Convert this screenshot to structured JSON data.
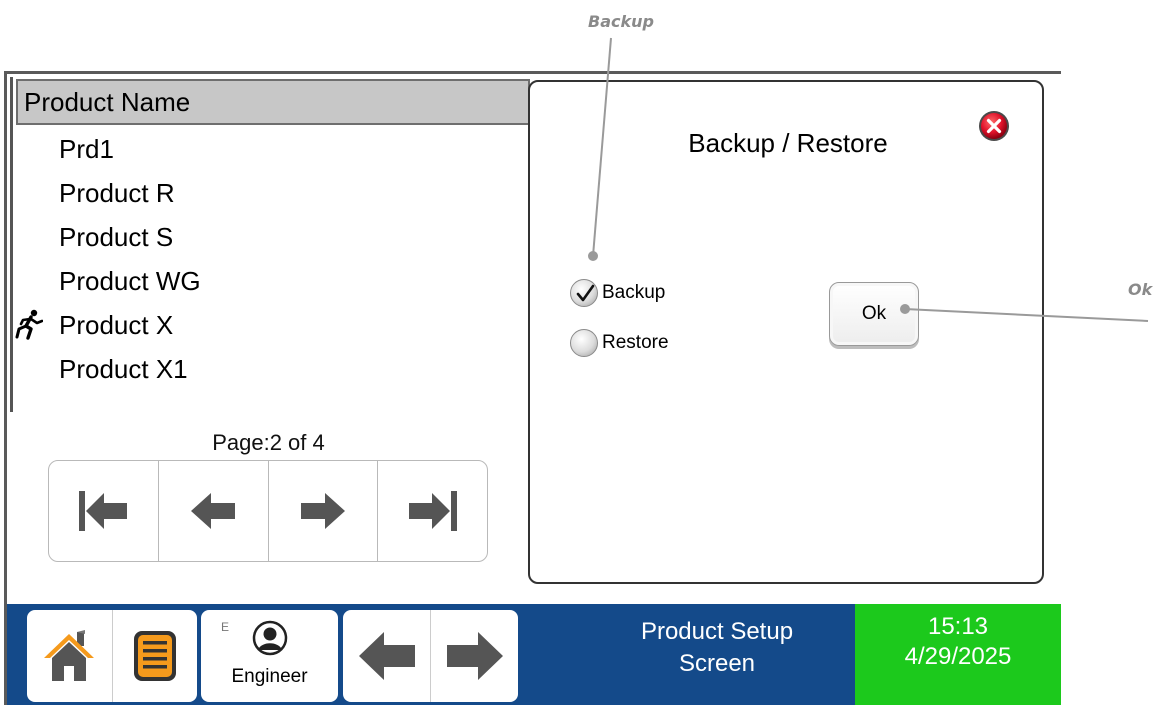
{
  "callouts": {
    "backup": "Backup",
    "ok": "Ok"
  },
  "product_list": {
    "header": "Product Name",
    "items": [
      {
        "name": "Prd1",
        "active": false
      },
      {
        "name": "Product R",
        "active": false
      },
      {
        "name": "Product S",
        "active": false
      },
      {
        "name": "Product WG",
        "active": false
      },
      {
        "name": "Product X",
        "active": true
      },
      {
        "name": "Product X1",
        "active": false
      }
    ],
    "page_label": "Page:2 of 4"
  },
  "dialog": {
    "title": "Backup / Restore",
    "options": [
      {
        "label": "Backup",
        "checked": true
      },
      {
        "label": "Restore",
        "checked": false
      }
    ],
    "ok_label": "Ok"
  },
  "navbar": {
    "user_level": "E",
    "user_name": "Engineer",
    "screen_name_line1": "Product Setup",
    "screen_name_line2": "Screen",
    "time": "15:13",
    "date": "4/29/2025"
  },
  "colors": {
    "navbar_bg": "#144a8a",
    "clock_bg": "#1cc91c",
    "home_icon": "#f59a1c",
    "menu_icon": "#f59a1c",
    "close_icon": "#e0132b",
    "arrow_gray": "#555555"
  },
  "icons": {
    "active_product": "runner-icon",
    "close": "close-icon",
    "home": "home-icon",
    "menu": "menu-icon",
    "user": "user-icon",
    "pager": [
      "first-page-icon",
      "previous-page-icon",
      "next-page-icon",
      "last-page-icon"
    ],
    "nav": [
      "back-arrow-icon",
      "forward-arrow-icon"
    ]
  }
}
